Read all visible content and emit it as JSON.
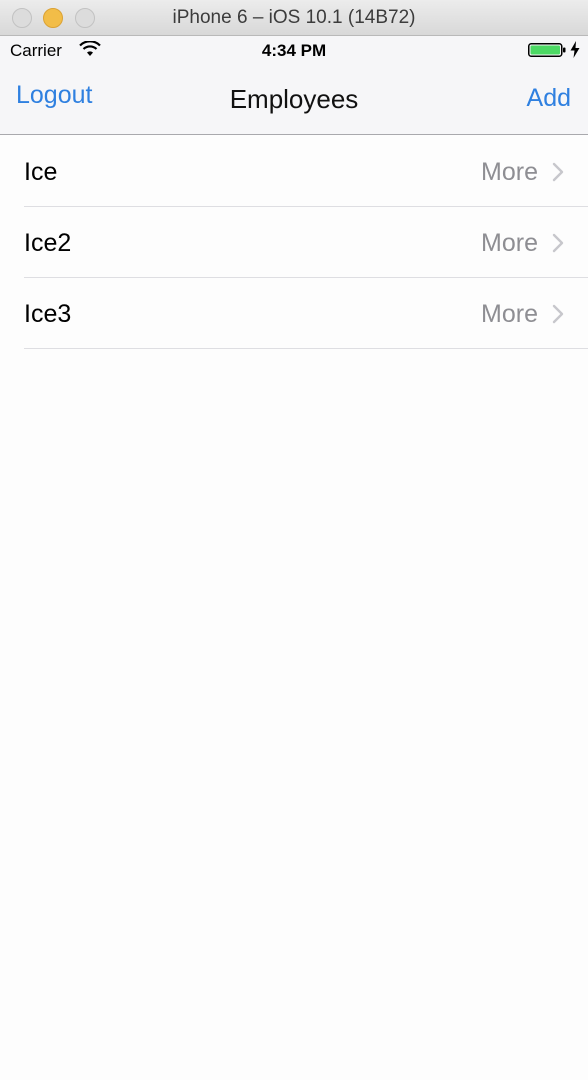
{
  "window": {
    "title": "iPhone 6 – iOS 10.1 (14B72)"
  },
  "status_bar": {
    "carrier": "Carrier",
    "time": "4:34 PM",
    "battery_color": "#4cd964"
  },
  "nav": {
    "left_button": "Logout",
    "title": "Employees",
    "right_button": "Add",
    "tint_color": "#2f80e0"
  },
  "rows": [
    {
      "title": "Ice",
      "detail": "More"
    },
    {
      "title": "Ice2",
      "detail": "More"
    },
    {
      "title": "Ice3",
      "detail": "More"
    }
  ]
}
